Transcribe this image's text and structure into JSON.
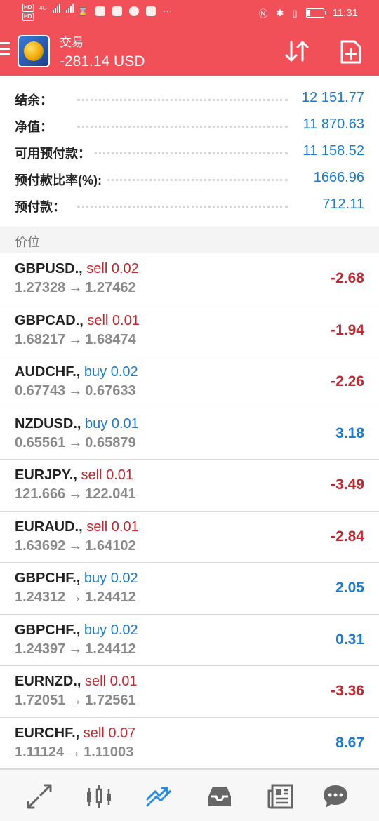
{
  "status_bar": {
    "hd_badges": [
      "HD",
      "HD"
    ],
    "network": "4G",
    "time": "11:31"
  },
  "header": {
    "title": "交易",
    "amount": "-281.14 USD"
  },
  "summary": [
    {
      "label": "结余：",
      "value": "12 151.77"
    },
    {
      "label": "净值：",
      "value": "11 870.63"
    },
    {
      "label": "可用预付款：",
      "value": "11 158.52"
    },
    {
      "label": "预付款比率(%):",
      "value": "1666.96"
    },
    {
      "label": "预付款：",
      "value": "712.11"
    }
  ],
  "section": {
    "title": "价位"
  },
  "trades": [
    {
      "symbol": "GBPUSD.,",
      "side": "sell 0.02",
      "type": "sell",
      "open": "1.27328",
      "arrow": "→",
      "current": "1.27462",
      "profit": "-2.68",
      "sign": "neg"
    },
    {
      "symbol": "GBPCAD.,",
      "side": "sell 0.01",
      "type": "sell",
      "open": "1.68217",
      "arrow": "→",
      "current": "1.68474",
      "profit": "-1.94",
      "sign": "neg"
    },
    {
      "symbol": "AUDCHF.,",
      "side": "buy 0.02",
      "type": "buy",
      "open": "0.67743",
      "arrow": "→",
      "current": "0.67633",
      "profit": "-2.26",
      "sign": "neg"
    },
    {
      "symbol": "NZDUSD.,",
      "side": "buy 0.01",
      "type": "buy",
      "open": "0.65561",
      "arrow": "→",
      "current": "0.65879",
      "profit": "3.18",
      "sign": "pos"
    },
    {
      "symbol": "EURJPY.,",
      "side": "sell 0.01",
      "type": "sell",
      "open": "121.666",
      "arrow": "→",
      "current": "122.041",
      "profit": "-3.49",
      "sign": "neg"
    },
    {
      "symbol": "EURAUD.,",
      "side": "sell 0.01",
      "type": "sell",
      "open": "1.63692",
      "arrow": "→",
      "current": "1.64102",
      "profit": "-2.84",
      "sign": "neg"
    },
    {
      "symbol": "GBPCHF.,",
      "side": "buy 0.02",
      "type": "buy",
      "open": "1.24312",
      "arrow": "→",
      "current": "1.24412",
      "profit": "2.05",
      "sign": "pos"
    },
    {
      "symbol": "GBPCHF.,",
      "side": "buy 0.02",
      "type": "buy",
      "open": "1.24397",
      "arrow": "→",
      "current": "1.24412",
      "profit": "0.31",
      "sign": "pos"
    },
    {
      "symbol": "EURNZD.,",
      "side": "sell 0.01",
      "type": "sell",
      "open": "1.72051",
      "arrow": "→",
      "current": "1.72561",
      "profit": "-3.36",
      "sign": "neg"
    },
    {
      "symbol": "EURCHF.,",
      "side": "sell 0.07",
      "type": "sell",
      "open": "1.11124",
      "arrow": "→",
      "current": "1.11003",
      "profit": "8.67",
      "sign": "pos"
    }
  ],
  "bottom_nav": [
    {
      "icon": "quotes-icon",
      "active": false
    },
    {
      "icon": "chart-candles-icon",
      "active": false
    },
    {
      "icon": "trade-icon",
      "active": true
    },
    {
      "icon": "history-inbox-icon",
      "active": false
    },
    {
      "icon": "news-icon",
      "active": false
    },
    {
      "icon": "chat-icon",
      "active": false
    }
  ],
  "colors": {
    "brand_red": "#f25058",
    "positive_blue": "#1a7bd2",
    "negative_red": "#c2282f",
    "muted_gray": "#8a8a8a"
  }
}
